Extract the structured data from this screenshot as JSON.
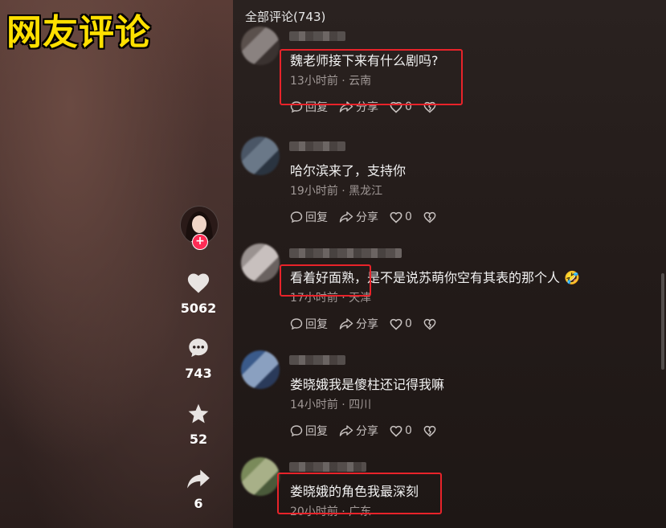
{
  "watermark": {
    "text": "网友评论",
    "color": "#ffe000"
  },
  "author": {
    "follow_badge": "+"
  },
  "actions": {
    "likes": "5062",
    "comments": "743",
    "favorites": "52",
    "shares": "6"
  },
  "comments_header": "全部评论(743)",
  "comment_labels": {
    "reply": "回复",
    "share": "分享"
  },
  "comments": [
    {
      "text": "魏老师接下来有什么剧吗?",
      "meta": "13小时前 · 云南",
      "likes": "0"
    },
    {
      "text": "哈尔滨来了，支持你",
      "meta": "19小时前 · 黑龙江",
      "likes": "0"
    },
    {
      "text": "看着好面熟，是不是说苏萌你空有其表的那个人",
      "emoji": "🤣",
      "meta": "17小时前 · 天津",
      "likes": "0"
    },
    {
      "text": "娄晓娥我是傻柱还记得我嘛",
      "meta": "14小时前 · 四川",
      "likes": "0"
    },
    {
      "text": "娄晓娥的角色我最深刻",
      "meta": "20小时前 · 广东"
    }
  ],
  "colors": {
    "highlight": "#e8232a",
    "badge": "#fe2c55"
  }
}
